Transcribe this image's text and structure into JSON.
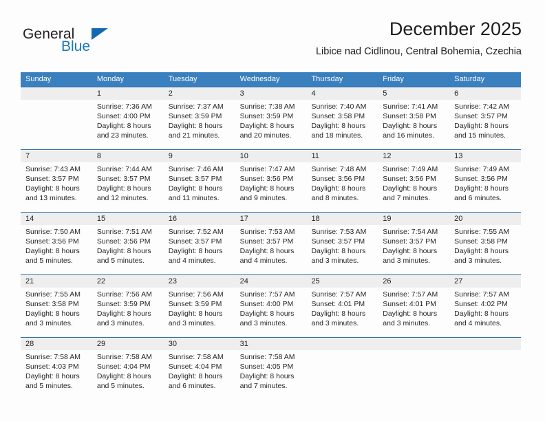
{
  "brand": {
    "name_part1": "General",
    "name_part2": "Blue",
    "triangle_color": "#1268b3",
    "blue_text_color": "#1878be"
  },
  "header": {
    "title": "December 2025",
    "subtitle": "Libice nad Cidlinou, Central Bohemia, Czechia"
  },
  "theme": {
    "header_row_bg": "#3a7fbe",
    "week_divider": "#2f6fab",
    "daynum_bg": "#eeeeee",
    "page_bg": "#fdfdfd"
  },
  "calendar": {
    "weekdays": [
      "Sunday",
      "Monday",
      "Tuesday",
      "Wednesday",
      "Thursday",
      "Friday",
      "Saturday"
    ],
    "weeks": [
      {
        "days": [
          {
            "num": "",
            "sunrise": "",
            "sunset": "",
            "daylight1": "",
            "daylight2": ""
          },
          {
            "num": "1",
            "sunrise": "Sunrise: 7:36 AM",
            "sunset": "Sunset: 4:00 PM",
            "daylight1": "Daylight: 8 hours",
            "daylight2": "and 23 minutes."
          },
          {
            "num": "2",
            "sunrise": "Sunrise: 7:37 AM",
            "sunset": "Sunset: 3:59 PM",
            "daylight1": "Daylight: 8 hours",
            "daylight2": "and 21 minutes."
          },
          {
            "num": "3",
            "sunrise": "Sunrise: 7:38 AM",
            "sunset": "Sunset: 3:59 PM",
            "daylight1": "Daylight: 8 hours",
            "daylight2": "and 20 minutes."
          },
          {
            "num": "4",
            "sunrise": "Sunrise: 7:40 AM",
            "sunset": "Sunset: 3:58 PM",
            "daylight1": "Daylight: 8 hours",
            "daylight2": "and 18 minutes."
          },
          {
            "num": "5",
            "sunrise": "Sunrise: 7:41 AM",
            "sunset": "Sunset: 3:58 PM",
            "daylight1": "Daylight: 8 hours",
            "daylight2": "and 16 minutes."
          },
          {
            "num": "6",
            "sunrise": "Sunrise: 7:42 AM",
            "sunset": "Sunset: 3:57 PM",
            "daylight1": "Daylight: 8 hours",
            "daylight2": "and 15 minutes."
          }
        ]
      },
      {
        "days": [
          {
            "num": "7",
            "sunrise": "Sunrise: 7:43 AM",
            "sunset": "Sunset: 3:57 PM",
            "daylight1": "Daylight: 8 hours",
            "daylight2": "and 13 minutes."
          },
          {
            "num": "8",
            "sunrise": "Sunrise: 7:44 AM",
            "sunset": "Sunset: 3:57 PM",
            "daylight1": "Daylight: 8 hours",
            "daylight2": "and 12 minutes."
          },
          {
            "num": "9",
            "sunrise": "Sunrise: 7:46 AM",
            "sunset": "Sunset: 3:57 PM",
            "daylight1": "Daylight: 8 hours",
            "daylight2": "and 11 minutes."
          },
          {
            "num": "10",
            "sunrise": "Sunrise: 7:47 AM",
            "sunset": "Sunset: 3:56 PM",
            "daylight1": "Daylight: 8 hours",
            "daylight2": "and 9 minutes."
          },
          {
            "num": "11",
            "sunrise": "Sunrise: 7:48 AM",
            "sunset": "Sunset: 3:56 PM",
            "daylight1": "Daylight: 8 hours",
            "daylight2": "and 8 minutes."
          },
          {
            "num": "12",
            "sunrise": "Sunrise: 7:49 AM",
            "sunset": "Sunset: 3:56 PM",
            "daylight1": "Daylight: 8 hours",
            "daylight2": "and 7 minutes."
          },
          {
            "num": "13",
            "sunrise": "Sunrise: 7:49 AM",
            "sunset": "Sunset: 3:56 PM",
            "daylight1": "Daylight: 8 hours",
            "daylight2": "and 6 minutes."
          }
        ]
      },
      {
        "days": [
          {
            "num": "14",
            "sunrise": "Sunrise: 7:50 AM",
            "sunset": "Sunset: 3:56 PM",
            "daylight1": "Daylight: 8 hours",
            "daylight2": "and 5 minutes."
          },
          {
            "num": "15",
            "sunrise": "Sunrise: 7:51 AM",
            "sunset": "Sunset: 3:56 PM",
            "daylight1": "Daylight: 8 hours",
            "daylight2": "and 5 minutes."
          },
          {
            "num": "16",
            "sunrise": "Sunrise: 7:52 AM",
            "sunset": "Sunset: 3:57 PM",
            "daylight1": "Daylight: 8 hours",
            "daylight2": "and 4 minutes."
          },
          {
            "num": "17",
            "sunrise": "Sunrise: 7:53 AM",
            "sunset": "Sunset: 3:57 PM",
            "daylight1": "Daylight: 8 hours",
            "daylight2": "and 4 minutes."
          },
          {
            "num": "18",
            "sunrise": "Sunrise: 7:53 AM",
            "sunset": "Sunset: 3:57 PM",
            "daylight1": "Daylight: 8 hours",
            "daylight2": "and 3 minutes."
          },
          {
            "num": "19",
            "sunrise": "Sunrise: 7:54 AM",
            "sunset": "Sunset: 3:57 PM",
            "daylight1": "Daylight: 8 hours",
            "daylight2": "and 3 minutes."
          },
          {
            "num": "20",
            "sunrise": "Sunrise: 7:55 AM",
            "sunset": "Sunset: 3:58 PM",
            "daylight1": "Daylight: 8 hours",
            "daylight2": "and 3 minutes."
          }
        ]
      },
      {
        "days": [
          {
            "num": "21",
            "sunrise": "Sunrise: 7:55 AM",
            "sunset": "Sunset: 3:58 PM",
            "daylight1": "Daylight: 8 hours",
            "daylight2": "and 3 minutes."
          },
          {
            "num": "22",
            "sunrise": "Sunrise: 7:56 AM",
            "sunset": "Sunset: 3:59 PM",
            "daylight1": "Daylight: 8 hours",
            "daylight2": "and 3 minutes."
          },
          {
            "num": "23",
            "sunrise": "Sunrise: 7:56 AM",
            "sunset": "Sunset: 3:59 PM",
            "daylight1": "Daylight: 8 hours",
            "daylight2": "and 3 minutes."
          },
          {
            "num": "24",
            "sunrise": "Sunrise: 7:57 AM",
            "sunset": "Sunset: 4:00 PM",
            "daylight1": "Daylight: 8 hours",
            "daylight2": "and 3 minutes."
          },
          {
            "num": "25",
            "sunrise": "Sunrise: 7:57 AM",
            "sunset": "Sunset: 4:01 PM",
            "daylight1": "Daylight: 8 hours",
            "daylight2": "and 3 minutes."
          },
          {
            "num": "26",
            "sunrise": "Sunrise: 7:57 AM",
            "sunset": "Sunset: 4:01 PM",
            "daylight1": "Daylight: 8 hours",
            "daylight2": "and 3 minutes."
          },
          {
            "num": "27",
            "sunrise": "Sunrise: 7:57 AM",
            "sunset": "Sunset: 4:02 PM",
            "daylight1": "Daylight: 8 hours",
            "daylight2": "and 4 minutes."
          }
        ]
      },
      {
        "days": [
          {
            "num": "28",
            "sunrise": "Sunrise: 7:58 AM",
            "sunset": "Sunset: 4:03 PM",
            "daylight1": "Daylight: 8 hours",
            "daylight2": "and 5 minutes."
          },
          {
            "num": "29",
            "sunrise": "Sunrise: 7:58 AM",
            "sunset": "Sunset: 4:04 PM",
            "daylight1": "Daylight: 8 hours",
            "daylight2": "and 5 minutes."
          },
          {
            "num": "30",
            "sunrise": "Sunrise: 7:58 AM",
            "sunset": "Sunset: 4:04 PM",
            "daylight1": "Daylight: 8 hours",
            "daylight2": "and 6 minutes."
          },
          {
            "num": "31",
            "sunrise": "Sunrise: 7:58 AM",
            "sunset": "Sunset: 4:05 PM",
            "daylight1": "Daylight: 8 hours",
            "daylight2": "and 7 minutes."
          },
          {
            "num": "",
            "sunrise": "",
            "sunset": "",
            "daylight1": "",
            "daylight2": ""
          },
          {
            "num": "",
            "sunrise": "",
            "sunset": "",
            "daylight1": "",
            "daylight2": ""
          },
          {
            "num": "",
            "sunrise": "",
            "sunset": "",
            "daylight1": "",
            "daylight2": ""
          }
        ]
      }
    ]
  }
}
